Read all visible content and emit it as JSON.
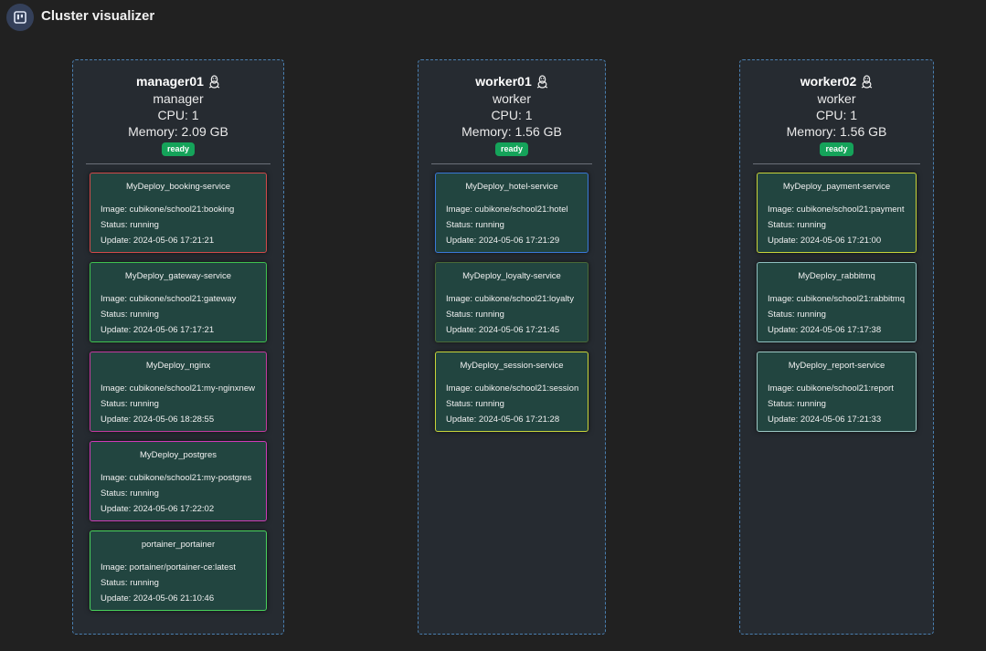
{
  "app": {
    "title": "Cluster visualizer",
    "icon": "board-icon"
  },
  "nodes": [
    {
      "name": "manager01",
      "role": "manager",
      "cpu": "CPU: 1",
      "memory": "Memory: 2.09 GB",
      "os_icon": "linux-penguin-icon",
      "status": "ready",
      "tasks": [
        {
          "name": "MyDeploy_booking-service",
          "image": "Image: cubikone/school21:booking",
          "status": "Status: running",
          "update": "Update: 2024-05-06 17:21:21",
          "color": "#d24a4a"
        },
        {
          "name": "MyDeploy_gateway-service",
          "image": "Image: cubikone/school21:gateway",
          "status": "Status: running",
          "update": "Update: 2024-05-06 17:17:21",
          "color": "#3fc24f"
        },
        {
          "name": "MyDeploy_nginx",
          "image": "Image: cubikone/school21:my-nginxnew",
          "status": "Status: running",
          "update": "Update: 2024-05-06 18:28:55",
          "color": "#c43aa0"
        },
        {
          "name": "MyDeploy_postgres",
          "image": "Image: cubikone/school21:my-postgres",
          "status": "Status: running",
          "update": "Update: 2024-05-06 17:22:02",
          "color": "#cf3ab8"
        },
        {
          "name": "portainer_portainer",
          "image": "Image: portainer/portainer-ce:latest",
          "status": "Status: running",
          "update": "Update: 2024-05-06 21:10:46",
          "color": "#49d25c"
        }
      ]
    },
    {
      "name": "worker01",
      "role": "worker",
      "cpu": "CPU: 1",
      "memory": "Memory: 1.56 GB",
      "os_icon": "linux-penguin-icon",
      "status": "ready",
      "tasks": [
        {
          "name": "MyDeploy_hotel-service",
          "image": "Image: cubikone/school21:hotel",
          "status": "Status: running",
          "update": "Update: 2024-05-06 17:21:29",
          "color": "#3a78d8"
        },
        {
          "name": "MyDeploy_loyalty-service",
          "image": "Image: cubikone/school21:loyalty",
          "status": "Status: running",
          "update": "Update: 2024-05-06 17:21:45",
          "color": "#4a6a38"
        },
        {
          "name": "MyDeploy_session-service",
          "image": "Image: cubikone/school21:session",
          "status": "Status: running",
          "update": "Update: 2024-05-06 17:21:28",
          "color": "#c8d43a"
        }
      ]
    },
    {
      "name": "worker02",
      "role": "worker",
      "cpu": "CPU: 1",
      "memory": "Memory: 1.56 GB",
      "os_icon": "linux-penguin-icon",
      "status": "ready",
      "tasks": [
        {
          "name": "MyDeploy_payment-service",
          "image": "Image: cubikone/school21:payment",
          "status": "Status: running",
          "update": "Update: 2024-05-06 17:21:00",
          "color": "#c8d43a"
        },
        {
          "name": "MyDeploy_rabbitmq",
          "image": "Image: cubikone/school21:rabbitmq",
          "status": "Status: running",
          "update": "Update: 2024-05-06 17:17:38",
          "color": "#8fc0c0"
        },
        {
          "name": "MyDeploy_report-service",
          "image": "Image: cubikone/school21:report",
          "status": "Status: running",
          "update": "Update: 2024-05-06 17:21:33",
          "color": "#9cc8c4"
        }
      ]
    }
  ]
}
